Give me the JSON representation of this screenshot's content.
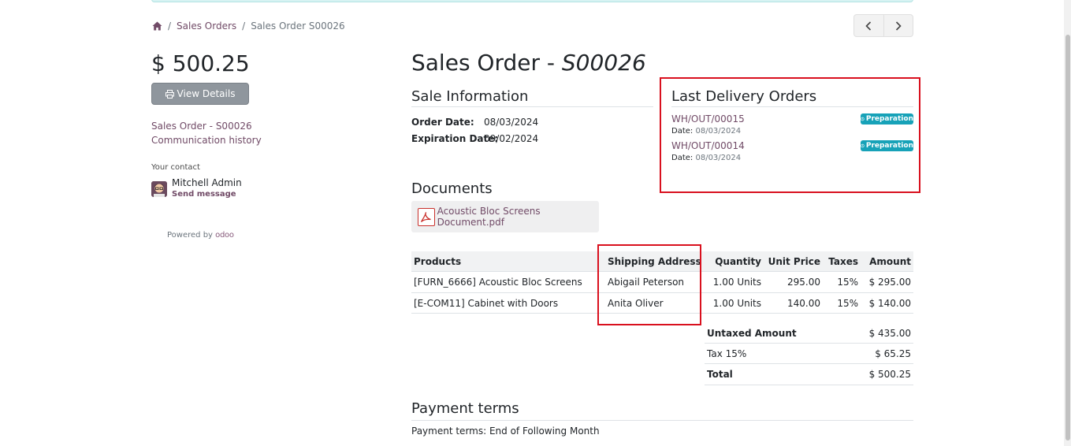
{
  "breadcrumb": {
    "home_icon": "home-icon",
    "parent": "Sales Orders",
    "current": "Sales Order S00026"
  },
  "pager": {
    "prev_icon": "chevron-left-icon",
    "next_icon": "chevron-right-icon"
  },
  "sidebar": {
    "amount": "$ 500.25",
    "view_details_label": "View Details",
    "print_icon": "printer-icon",
    "order_link": "Sales Order - S00026",
    "history_link": "Communication history",
    "contact_label": "Your contact",
    "contact_name": "Mitchell Admin",
    "send_message": "Send message",
    "powered_by": "Powered by",
    "powered_brand": "odoo"
  },
  "order": {
    "title_prefix": "Sales Order - ",
    "title_ref": "S00026"
  },
  "sale_info": {
    "heading": "Sale Information",
    "order_date_label": "Order Date:",
    "order_date": "08/03/2024",
    "expiration_date_label": "Expiration Date:",
    "expiration_date": "09/02/2024"
  },
  "deliveries": {
    "heading": "Last Delivery Orders",
    "date_label": "Date:",
    "items": [
      {
        "ref": "WH/OUT/00015",
        "date": "08/03/2024",
        "status": "Preparation"
      },
      {
        "ref": "WH/OUT/00014",
        "date": "08/03/2024",
        "status": "Preparation"
      }
    ]
  },
  "documents": {
    "heading": "Documents",
    "items": [
      {
        "name": "Acoustic Bloc Screens Document.pdf",
        "icon": "pdf-file-icon"
      }
    ]
  },
  "lines": {
    "headers": {
      "product": "Products",
      "shipping": "Shipping Address",
      "quantity": "Quantity",
      "unit_price": "Unit Price",
      "taxes": "Taxes",
      "amount": "Amount"
    },
    "rows": [
      {
        "product": "[FURN_6666] Acoustic Bloc Screens",
        "shipping": "Abigail Peterson",
        "quantity": "1.00 Units",
        "unit_price": "295.00",
        "taxes": "15%",
        "amount": "$ 295.00"
      },
      {
        "product": "[E-COM11] Cabinet with Doors",
        "shipping": "Anita Oliver",
        "quantity": "1.00 Units",
        "unit_price": "140.00",
        "taxes": "15%",
        "amount": "$ 140.00"
      }
    ]
  },
  "totals": {
    "untaxed_label": "Untaxed Amount",
    "untaxed": "$ 435.00",
    "tax_label": "Tax 15%",
    "tax": "$ 65.25",
    "total_label": "Total",
    "total": "$ 500.25"
  },
  "payment": {
    "heading": "Payment terms",
    "text": "Payment terms: End of Following Month"
  },
  "colors": {
    "brand": "#714b67",
    "badge": "#17a2b8",
    "highlight": "#d9101e"
  }
}
